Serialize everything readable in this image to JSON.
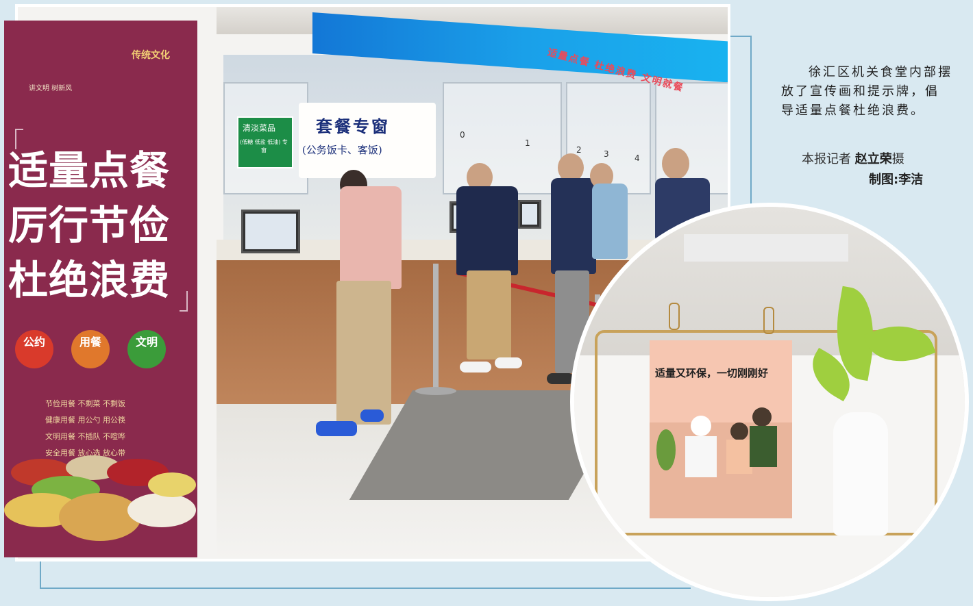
{
  "caption": {
    "text": "徐汇区机关食堂内部摆放了宣传画和提示牌，倡导适量点餐杜绝浪费。",
    "reporter_prefix": "本报记者",
    "reporter_name": "赵立荣",
    "reporter_suffix": "摄",
    "design": "制图:李洁"
  },
  "banner": {
    "top_label": "传统文化",
    "small_text": "讲文明 树新风",
    "line1": "适量点餐",
    "line2": "厉行节俭",
    "line3": "杜绝浪费",
    "badges": [
      "公约",
      "用餐",
      "文明"
    ],
    "rules": [
      "节俭用餐  不剩菜  不剩饭",
      "健康用餐  用公勺  用公筷",
      "文明用餐  不插队  不喧哗",
      "安全用餐  放心选  放心带"
    ]
  },
  "scene": {
    "window_sign_title": "套餐专窗",
    "window_sign_sub": "(公务饭卡、客饭)",
    "green_sign_title": "清淡菜品",
    "green_sign_sub": "(低糖 低盐 低油) 专窗",
    "window_numbers": [
      "0",
      "1",
      "2",
      "3",
      "4"
    ]
  },
  "inset": {
    "postcard_text": "适量又环保，一切刚刚好"
  },
  "colors": {
    "banner": "#8a2a4d",
    "led": "#1aa0e9",
    "frame": "#6fa9c7",
    "background": "#d9e9f1"
  }
}
